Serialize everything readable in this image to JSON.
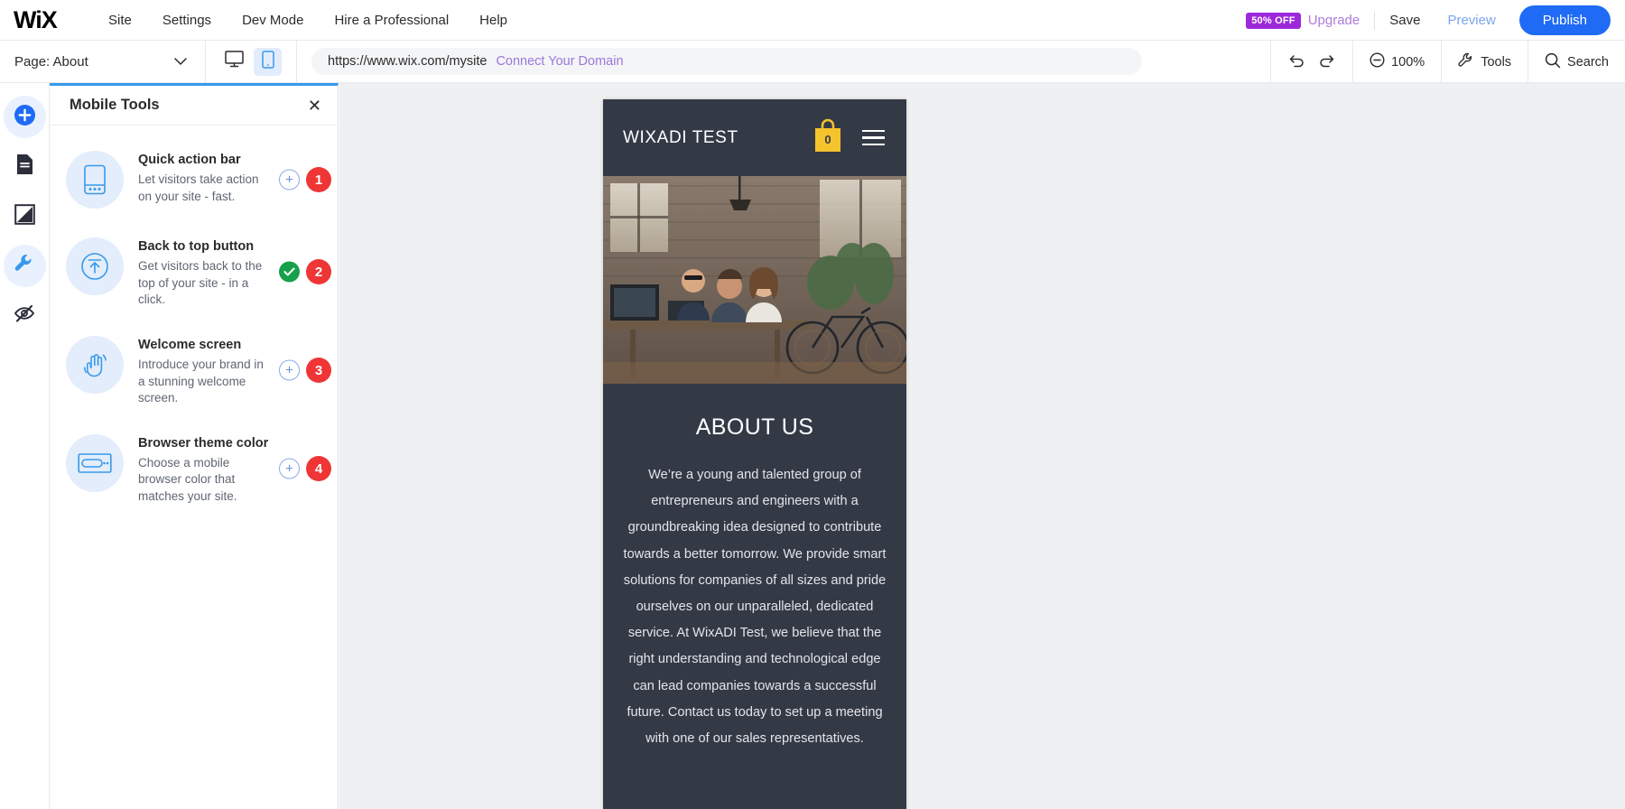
{
  "topbar": {
    "logo": "WiX",
    "menu": [
      "Site",
      "Settings",
      "Dev Mode",
      "Hire a Professional",
      "Help"
    ],
    "discount_badge": "50% OFF",
    "upgrade": "Upgrade",
    "save": "Save",
    "preview": "Preview",
    "publish": "Publish",
    "accent_blue": "#1f6bf5",
    "purple": "#9c29d9"
  },
  "secondbar": {
    "page_label": "Page: About",
    "chevron": "⌄",
    "desktop_icon": "desktop-icon",
    "mobile_icon": "mobile-icon",
    "url": "https://www.wix.com/mysite",
    "connect_domain": "Connect Your Domain",
    "undo": "undo-icon",
    "redo": "redo-icon",
    "zoom_level": "100%",
    "tools": "Tools",
    "search": "Search"
  },
  "sidebar": {
    "items": [
      {
        "name": "add-elements",
        "icon": "plus-icon",
        "highlight": true
      },
      {
        "name": "site-pages",
        "icon": "page-icon",
        "highlight": false
      },
      {
        "name": "site-design",
        "icon": "theme-icon",
        "highlight": false
      },
      {
        "name": "mobile-tools",
        "icon": "wrench-icon",
        "highlight": true
      },
      {
        "name": "hidden-elements",
        "icon": "hidden-eye-icon",
        "highlight": false
      }
    ]
  },
  "panel": {
    "title": "Mobile Tools",
    "close": "✕",
    "accent_top": "#3899ec",
    "tools": [
      {
        "title": "Quick action bar",
        "desc": "Let visitors take action on your site - fast.",
        "icon": "mobile-action-bar-icon",
        "state": "add",
        "action_label": "+",
        "badge": "1"
      },
      {
        "title": "Back to top button",
        "desc": "Get visitors back to the top of your site - in a click.",
        "icon": "back-to-top-icon",
        "state": "enabled",
        "action_label": "✓",
        "badge": "2"
      },
      {
        "title": "Welcome screen",
        "desc": "Introduce your brand in a stunning welcome screen.",
        "icon": "waving-hand-icon",
        "state": "add",
        "action_label": "+",
        "badge": "3"
      },
      {
        "title": "Browser theme color",
        "desc": "Choose a mobile browser color that matches your site.",
        "icon": "browser-bar-icon",
        "state": "add",
        "action_label": "+",
        "badge": "4"
      }
    ]
  },
  "preview": {
    "site_title": "WIXADI TEST",
    "cart_count": "0",
    "cart_icon": "shopping-bag-icon",
    "menu_icon": "hamburger-menu-icon",
    "hero_image": "office-team-photo",
    "about_heading": "ABOUT US",
    "about_text": "We’re a young and talented group of entrepreneurs and engineers with a groundbreaking idea designed to contribute towards a better tomorrow. We provide smart solutions for companies of all sizes and pride ourselves on our unparalleled, dedicated service. At WixADI Test, we believe that the right understanding and technological edge can lead companies towards a successful future. Contact us today to set up a meeting with one of our sales representatives.",
    "bg_color": "#343946",
    "cart_color": "#f5c32c"
  }
}
